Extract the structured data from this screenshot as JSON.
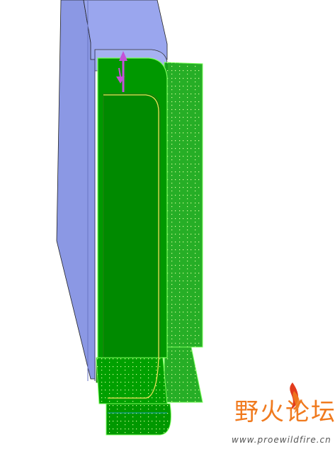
{
  "model_view": {
    "colors": {
      "solid_body": "#8f9ce6",
      "solid_body_dark": "#7f8bd8",
      "surface_fill": "#009a00",
      "surface_edge": "#7bff5c",
      "grid_dots": "#d8ff9a",
      "trim_curve": "#f0e05a",
      "drag_arrow": "#c452d8"
    },
    "drag_handle_icon": "double-arrow-icon"
  },
  "watermark": {
    "chinese": "野火论坛",
    "url": "www.proewildfire.cn",
    "logo_icon": "flame-icon"
  }
}
